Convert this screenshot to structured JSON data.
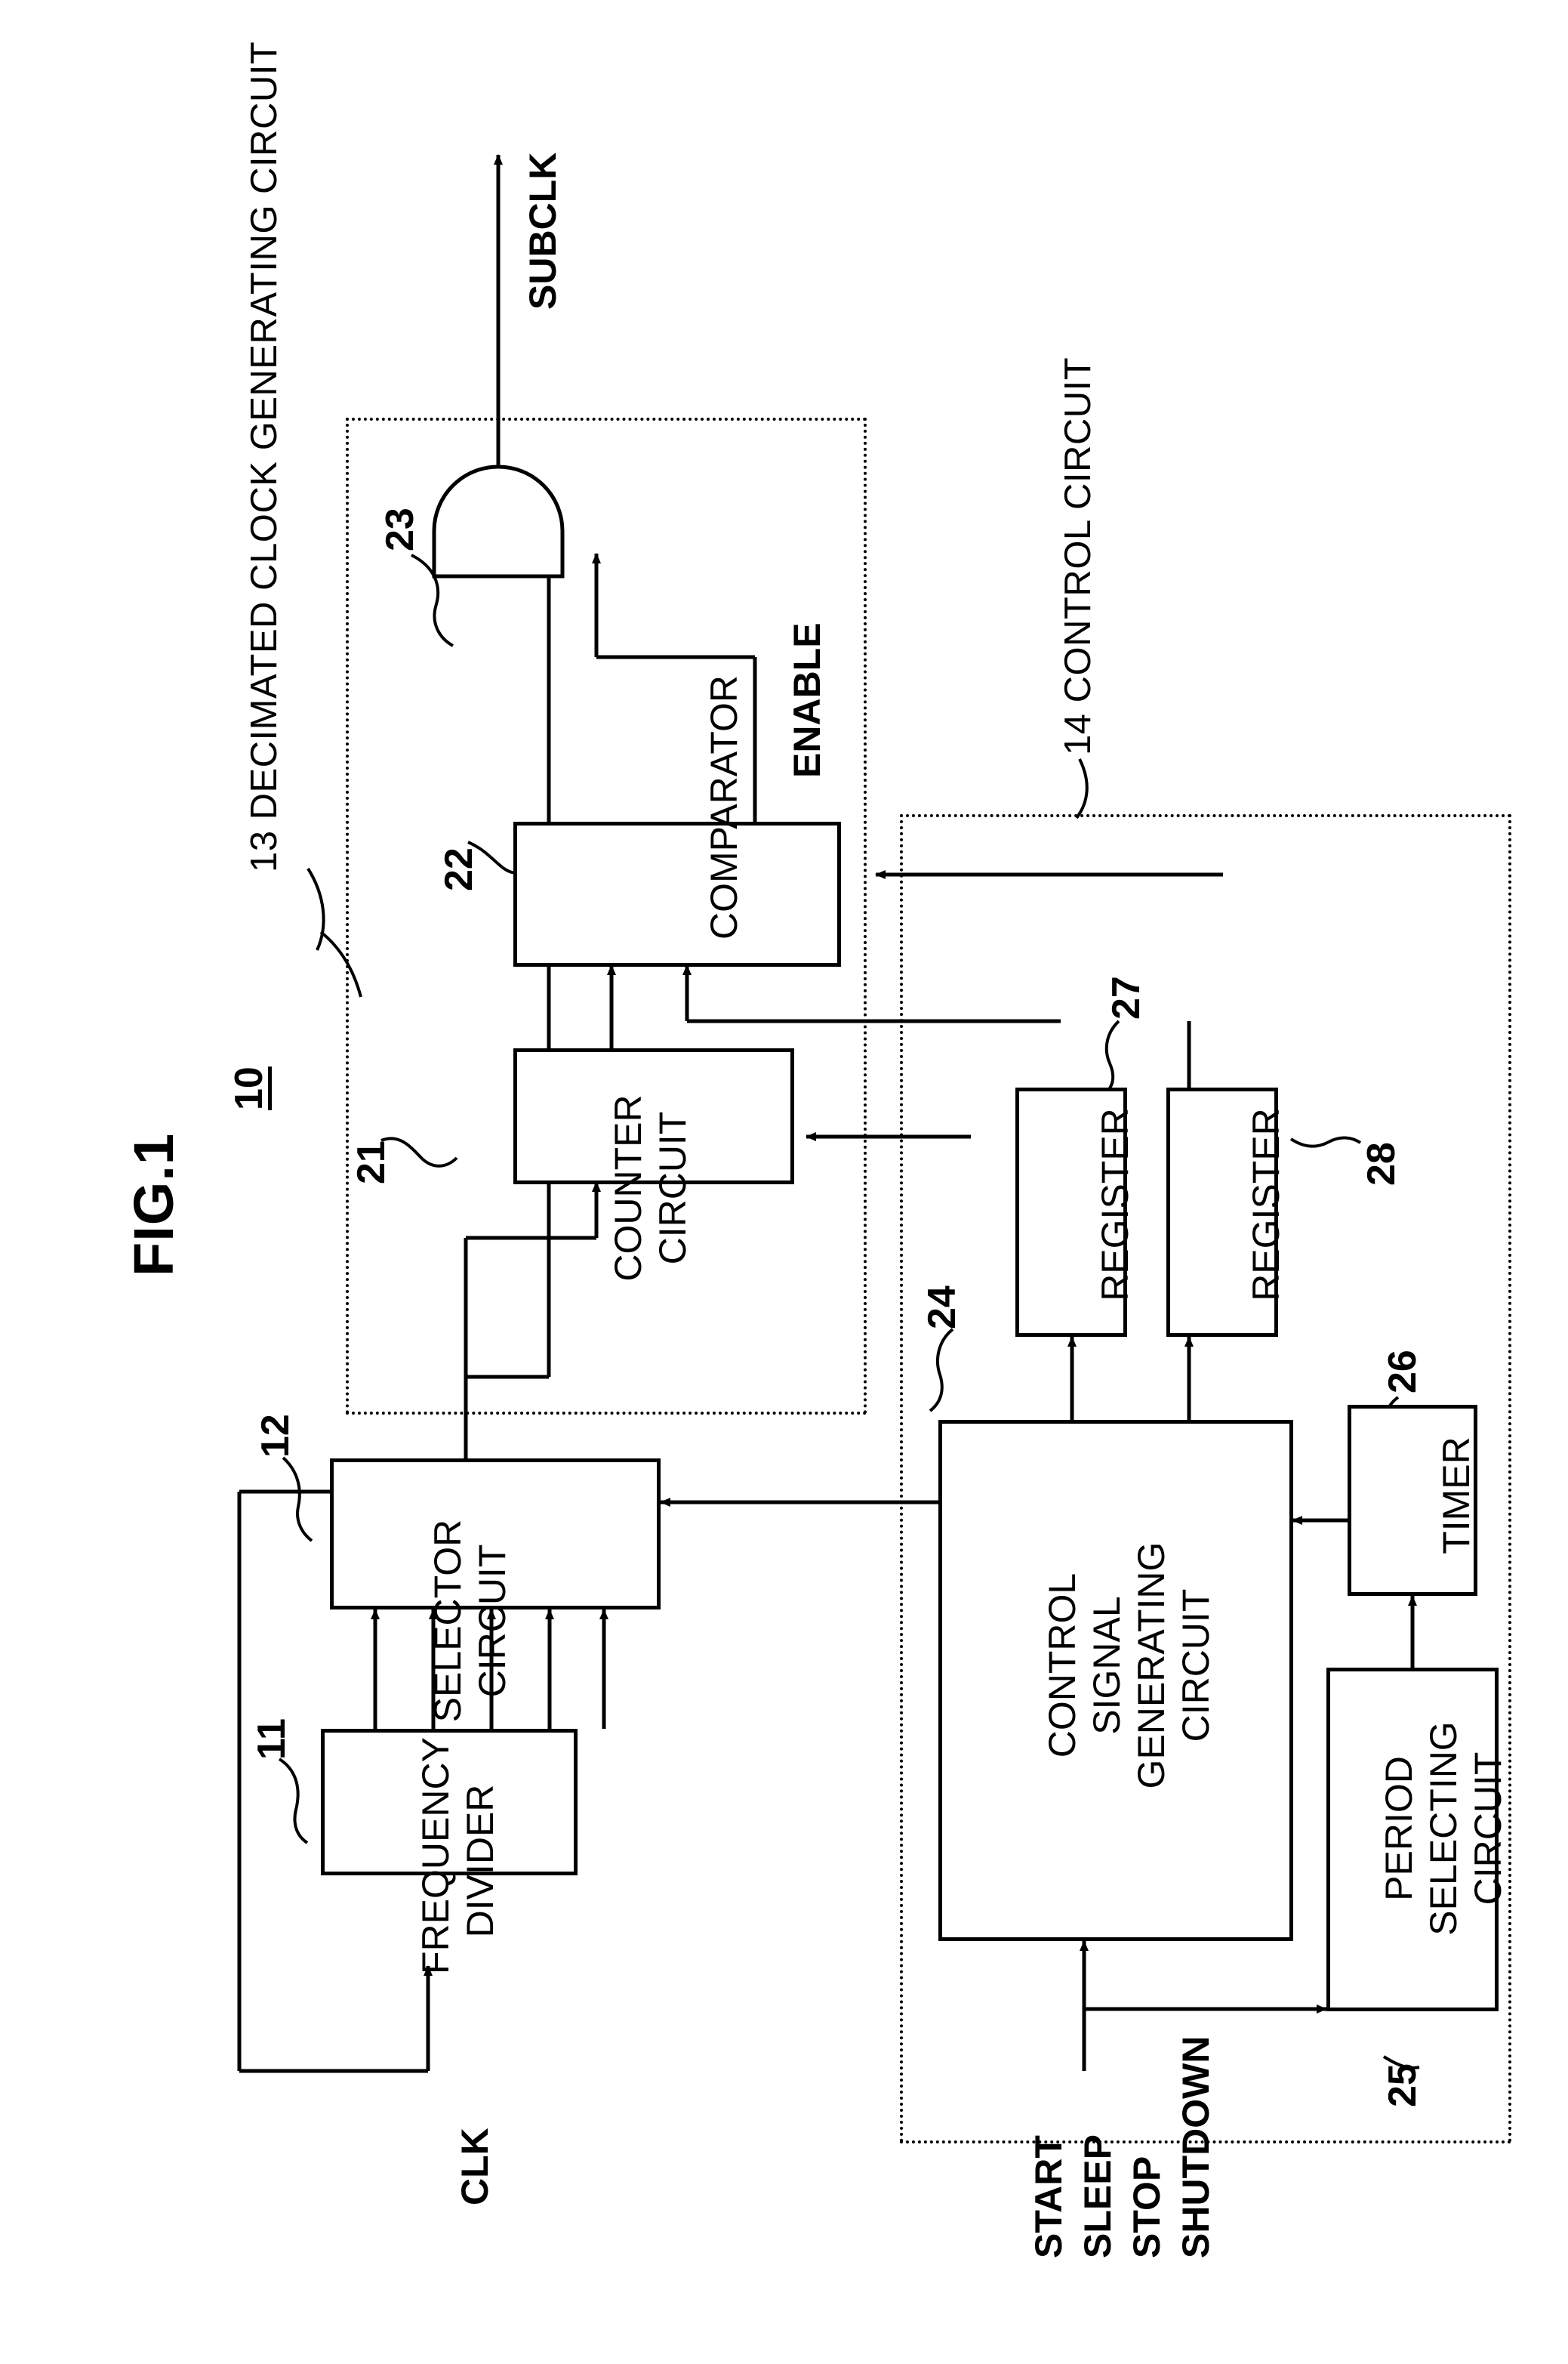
{
  "figure": {
    "title": "FIG.1",
    "system_ref": "10"
  },
  "groups": [
    {
      "id": "decimated-clock-generating-circuit",
      "label": "13 DECIMATED CLOCK GENERATING CIRCUIT"
    },
    {
      "id": "control-circuit",
      "label": "14 CONTROL CIRCUIT"
    }
  ],
  "blocks": [
    {
      "id": "frequency-divider",
      "label": "FREQUENCY\nDIVIDER",
      "ref": "11"
    },
    {
      "id": "selector-circuit",
      "label": "SELECTOR\nCIRCUIT",
      "ref": "12"
    },
    {
      "id": "counter-circuit",
      "label": "COUNTER\nCIRCUIT",
      "ref": "21"
    },
    {
      "id": "comparator",
      "label": "COMPARATOR",
      "ref": "22"
    },
    {
      "id": "and-gate",
      "label": "",
      "ref": "23"
    },
    {
      "id": "control-signal-generating-circuit",
      "label": "CONTROL\nSIGNAL\nGENERATING\nCIRCUIT",
      "ref": "24"
    },
    {
      "id": "period-selecting-circuit",
      "label": "PERIOD\nSELECTING\nCIRCUIT",
      "ref": "25"
    },
    {
      "id": "timer",
      "label": "TIMER",
      "ref": "26"
    },
    {
      "id": "register-27",
      "label": "REGISTER",
      "ref": "27"
    },
    {
      "id": "register-28",
      "label": "REGISTER",
      "ref": "28"
    }
  ],
  "signals": {
    "clk": "CLK",
    "subclk": "SUBCLK",
    "enable": "ENABLE",
    "inputs": [
      "START",
      "SLEEP",
      "STOP",
      "SHUTDOWN"
    ]
  },
  "colors": {
    "ink": "#000000",
    "paper": "#ffffff"
  }
}
